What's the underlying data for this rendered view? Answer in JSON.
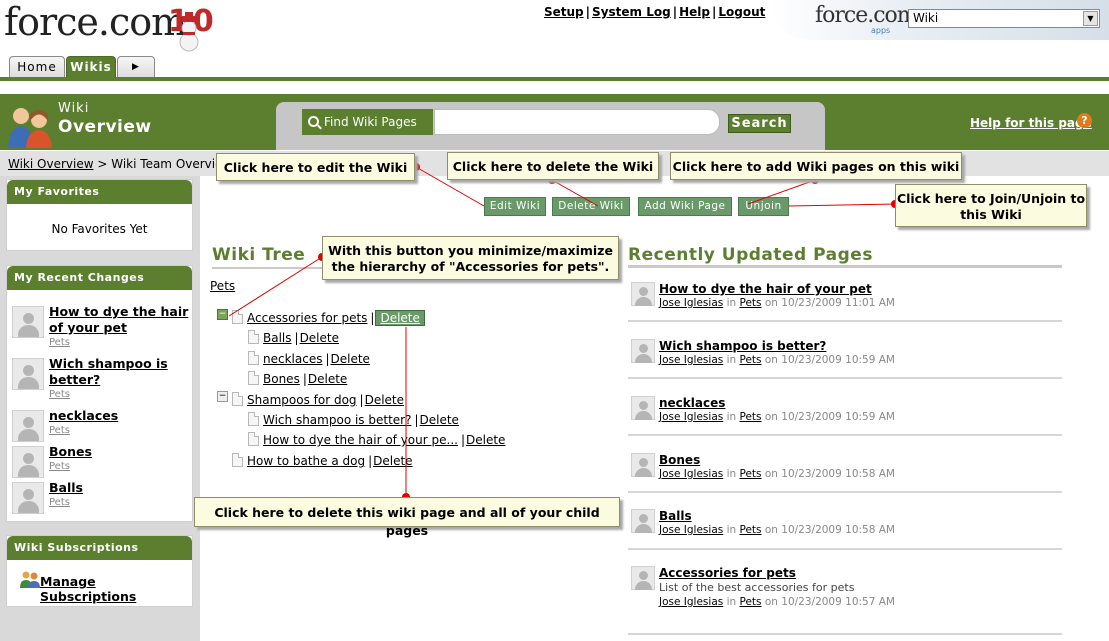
{
  "header": {
    "logo_text": "force.com",
    "anniversary_text": "10",
    "links": [
      "Setup",
      "System Log",
      "Help",
      "Logout"
    ],
    "brand_text": "force.com",
    "brand_sub": "apps",
    "app_select_value": "Wiki"
  },
  "tabs": [
    {
      "label": "Home",
      "active": false
    },
    {
      "label": "Wikis",
      "active": true
    }
  ],
  "page": {
    "type_label": "Wiki",
    "title": "Overview",
    "help_link": "Help for this page",
    "help_icon": "?"
  },
  "search": {
    "label": "Find Wiki Pages",
    "value": "",
    "button": "Search"
  },
  "breadcrumb": {
    "link": "Wiki Overview",
    "separator": ">",
    "current": "Wiki Team Overview"
  },
  "sidebar": {
    "favorites": {
      "title": "My Favorites",
      "empty_text": "No Favorites Yet"
    },
    "recent_changes": {
      "title": "My Recent Changes",
      "items": [
        {
          "title": "How to dye the hair of your pet",
          "wiki": "Pets"
        },
        {
          "title": "Wich shampoo is better?",
          "wiki": "Pets"
        },
        {
          "title": "necklaces",
          "wiki": "Pets"
        },
        {
          "title": "Bones",
          "wiki": "Pets"
        },
        {
          "title": "Balls",
          "wiki": "Pets"
        }
      ]
    },
    "subscriptions": {
      "title": "Wiki Subscriptions",
      "link": "Manage Subscriptions"
    }
  },
  "actions": {
    "edit": "Edit Wiki",
    "delete": "Delete Wiki",
    "add": "Add Wiki Page",
    "unjoin": "Unjoin"
  },
  "tree": {
    "heading": "Wiki Tree",
    "root": "Pets",
    "delete_label": "Delete",
    "pipe": "|",
    "nodes": [
      {
        "label": "Accessories for pets"
      },
      {
        "label": "Balls"
      },
      {
        "label": "necklaces"
      },
      {
        "label": "Bones"
      },
      {
        "label": "Shampoos for dog"
      },
      {
        "label": "Wich shampoo is better?"
      },
      {
        "label": "How to dye the hair of your pe..."
      },
      {
        "label": "How to bathe a dog"
      }
    ],
    "toggle_symbol": "−"
  },
  "recent": {
    "heading": "Recently Updated Pages",
    "author": "Jose Iglesias",
    "in_text": "in",
    "items": [
      {
        "title": "How to dye the hair of your pet",
        "desc": "",
        "wiki": "Pets",
        "date": "on 10/23/2009 11:01 AM"
      },
      {
        "title": "Wich shampoo is better?",
        "desc": "",
        "wiki": "Pets",
        "date": "on 10/23/2009 10:59 AM"
      },
      {
        "title": "necklaces",
        "desc": "",
        "wiki": "Pets",
        "date": "on 10/23/2009 10:59 AM"
      },
      {
        "title": "Bones",
        "desc": "",
        "wiki": "Pets",
        "date": "on 10/23/2009 10:58 AM"
      },
      {
        "title": "Balls",
        "desc": "",
        "wiki": "Pets",
        "date": "on 10/23/2009 10:58 AM"
      },
      {
        "title": "Accessories for pets",
        "desc": "List of the best accessories for pets",
        "wiki": "Pets",
        "date": "on 10/23/2009 10:57 AM"
      }
    ]
  },
  "callouts": {
    "edit": "Click here to edit the Wiki",
    "delete_wiki": "Click here to delete the Wiki",
    "add_pages": "Click here to add Wiki pages on this wiki",
    "join": "Click here to Join/Unjoin to this Wiki",
    "minmax": "With this button you minimize/maximize the hierarchy of \"Accessories for pets\".",
    "delete_page": "Click here to delete this wiki page and all of your child pages"
  },
  "colors": {
    "brand_green": "#5b7f2f",
    "button_green": "#6a9a6a",
    "callout_bg": "#fbfbe0",
    "arrow_red": "#e00000"
  }
}
